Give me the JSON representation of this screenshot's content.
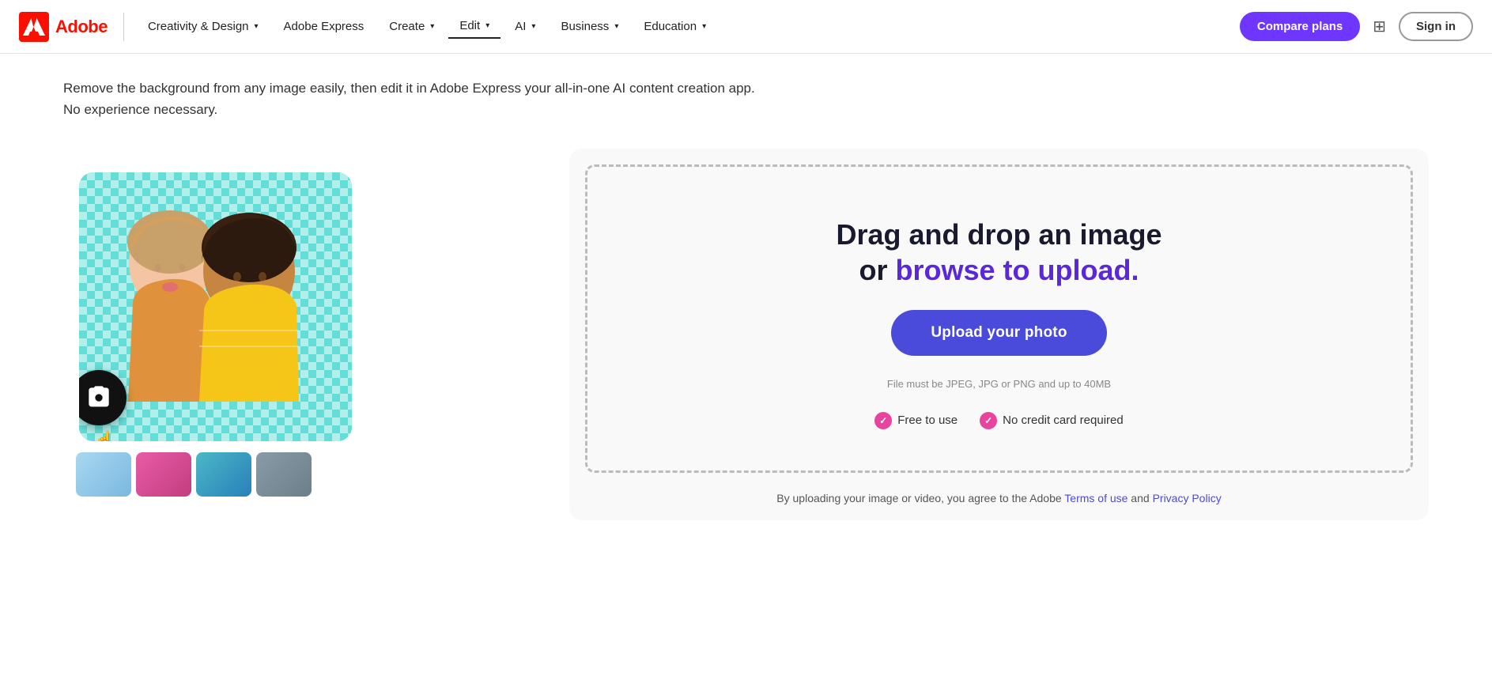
{
  "nav": {
    "logo_text": "Adobe",
    "creativity_design_label": "Creativity & Design",
    "adobe_express_label": "Adobe Express",
    "create_label": "Create",
    "edit_label": "Edit",
    "ai_label": "AI",
    "business_label": "Business",
    "education_label": "Education",
    "compare_plans_label": "Compare plans",
    "sign_in_label": "Sign in"
  },
  "main": {
    "subtitle": "Remove the background from any image easily, then edit it in Adobe Express your all-in-one AI content creation app. No experience necessary.",
    "drag_drop_line1": "Drag and drop an image",
    "drag_drop_or": "or ",
    "browse_link": "browse to upload.",
    "upload_btn_label": "Upload your photo",
    "file_req": "File must be JPEG, JPG or PNG and up to 40MB",
    "badge1_label": "Free to use",
    "badge2_label": "No credit card required",
    "tos_prefix": "By uploading your image or video, you agree to the Adobe ",
    "tos_link1": "Terms of use",
    "tos_and": " and ",
    "tos_link2": "Privacy Policy"
  }
}
